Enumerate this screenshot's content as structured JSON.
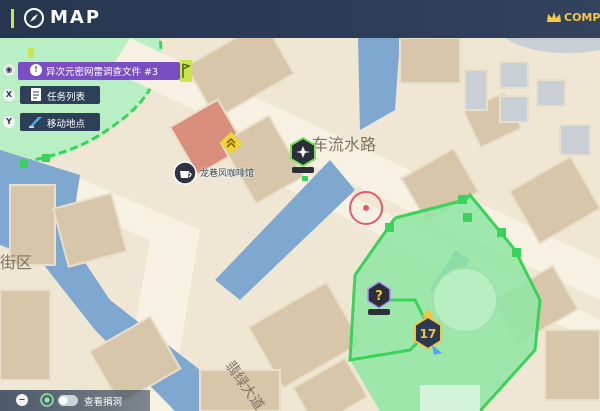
{
  "header": {
    "title": "MAP",
    "right_label": "COMP"
  },
  "mission": {
    "label": "异次元密网雷调查文件 #3",
    "icon": "exclamation-icon"
  },
  "controls": [
    {
      "key": "X",
      "label": "任务列表",
      "icon": "document-icon"
    },
    {
      "key": "Y",
      "label": "移动地点",
      "icon": "teleport-icon"
    }
  ],
  "map": {
    "road_labels": [
      "车流水路",
      "翡绿大道",
      "街区"
    ],
    "poi_label": "龙巷风咖啡馆",
    "level_badge": "17",
    "unknown_marker": "?"
  },
  "bottom": {
    "key": "−",
    "label": "查看捐洞"
  },
  "colors": {
    "header": "#2c3c57",
    "accent_green": "#3ad35a",
    "zone_fill": "#8fe6a3",
    "mission_purple": "#7a4ec2",
    "water": "#7ea8cf",
    "road": "#f4eedf",
    "building": "#d9c8ae"
  }
}
